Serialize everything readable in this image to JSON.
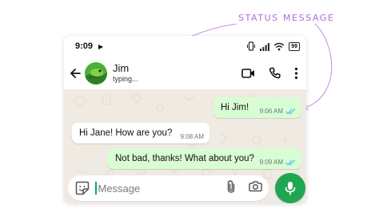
{
  "annotation": {
    "label": "STATUS MESSAGE",
    "color": "#b06bd8"
  },
  "status_bar": {
    "time": "9:09",
    "battery": "99"
  },
  "header": {
    "name": "Jim",
    "status": "typing...",
    "icons": {
      "back": "arrow-left-icon",
      "video": "video-call-icon",
      "call": "phone-icon",
      "menu": "more-vert-icon"
    }
  },
  "messages": [
    {
      "direction": "outgoing",
      "text": "Hi Jim!",
      "time": "9:06 AM",
      "read": true
    },
    {
      "direction": "incoming",
      "text": "Hi Jane! How are you?",
      "time": "9:08 AM"
    },
    {
      "direction": "outgoing",
      "text": "Not bad, thanks! What about you?",
      "time": "9:09 AM",
      "read": true
    }
  ],
  "composer": {
    "placeholder": "Message",
    "value": ""
  },
  "colors": {
    "outgoing_bubble": "#d9fdd3",
    "incoming_bubble": "#ffffff",
    "wallpaper": "#efeae2",
    "read_ticks": "#53bdeb",
    "mic_button": "#20a653"
  }
}
